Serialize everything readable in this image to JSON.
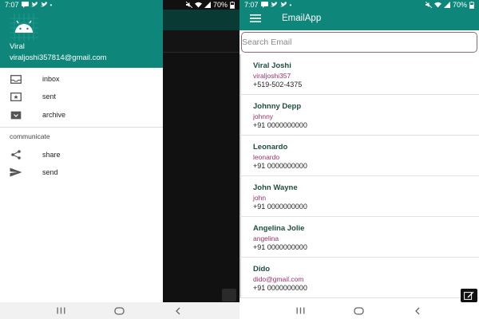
{
  "status_left": {
    "time": "7:07",
    "battery": "70%"
  },
  "status_right": {
    "time": "7:07",
    "battery": "70%"
  },
  "drawer": {
    "name": "Viral",
    "email": "viraljoshi357814@gmail.com",
    "items": [
      {
        "label": "inbox",
        "icon": "inbox-icon"
      },
      {
        "label": "sent",
        "icon": "sent-icon"
      },
      {
        "label": "archive",
        "icon": "archive-icon"
      }
    ],
    "section_title": "communicate",
    "section_items": [
      {
        "label": "share",
        "icon": "share-icon"
      },
      {
        "label": "send",
        "icon": "send-icon"
      }
    ]
  },
  "app": {
    "title": "EmailApp",
    "search_placeholder": "Search Email",
    "contacts": [
      {
        "name": "Viral Joshi",
        "username": "viraljoshi357",
        "phone": "+519-502-4375"
      },
      {
        "name": "Johnny Depp",
        "username": "johnny",
        "phone": "+91 0000000000"
      },
      {
        "name": "Leonardo",
        "username": "leonardo",
        "phone": "+91 0000000000"
      },
      {
        "name": "John Wayne",
        "username": "john",
        "phone": "+91 0000000000"
      },
      {
        "name": "Angelina Jolie",
        "username": "angelina",
        "phone": "+91 0000000000"
      },
      {
        "name": "Dido",
        "username": "dido@gmail.com",
        "phone": "+91 0000000000"
      }
    ]
  },
  "colors": {
    "primary": "#0e877a",
    "name": "#1e4d40",
    "username": "#a0306a"
  }
}
